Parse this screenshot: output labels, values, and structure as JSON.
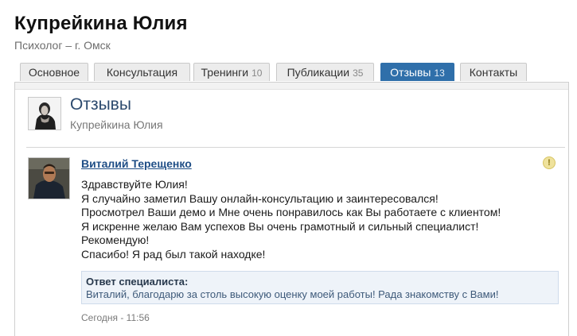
{
  "profile": {
    "name": "Купрейкина Юлия",
    "subtitle": "Психолог – г. Омск"
  },
  "tabs": [
    {
      "label": "Основное",
      "count": ""
    },
    {
      "label": "Консультация",
      "count": ""
    },
    {
      "label": "Тренинги",
      "count": "10"
    },
    {
      "label": "Публикации",
      "count": "35"
    },
    {
      "label": "Отзывы",
      "count": "13",
      "active": true
    },
    {
      "label": "Контакты",
      "count": ""
    }
  ],
  "reviews_header": {
    "title": "Отзывы",
    "subtitle": "Купрейкина Юлия"
  },
  "review": {
    "author": "Виталий Терещенко",
    "lines": [
      "Здравствуйте Юлия!",
      "Я случайно заметил Вашу онлайн-консультацию и заинтересовался!",
      "Просмотрел Ваши демо и Мне очень понравилось как Вы работаете с клиентом!",
      "Я искренне желаю Вам успехов Вы очень грамотный и сильный специалист!",
      "Рекомендую!",
      "Спасибо! Я рад был такой находке!"
    ],
    "reply_title": "Ответ специалиста:",
    "reply_text": "Виталий, благодарю за столь высокую оценку моей работы! Рада знакомству с Вами!",
    "time": "Сегодня - 11:56",
    "warning_icon": "exclamation-icon"
  },
  "colors": {
    "accent": "#2f6faa",
    "link": "#1f4e86",
    "reply_bg": "#eef3f9"
  }
}
